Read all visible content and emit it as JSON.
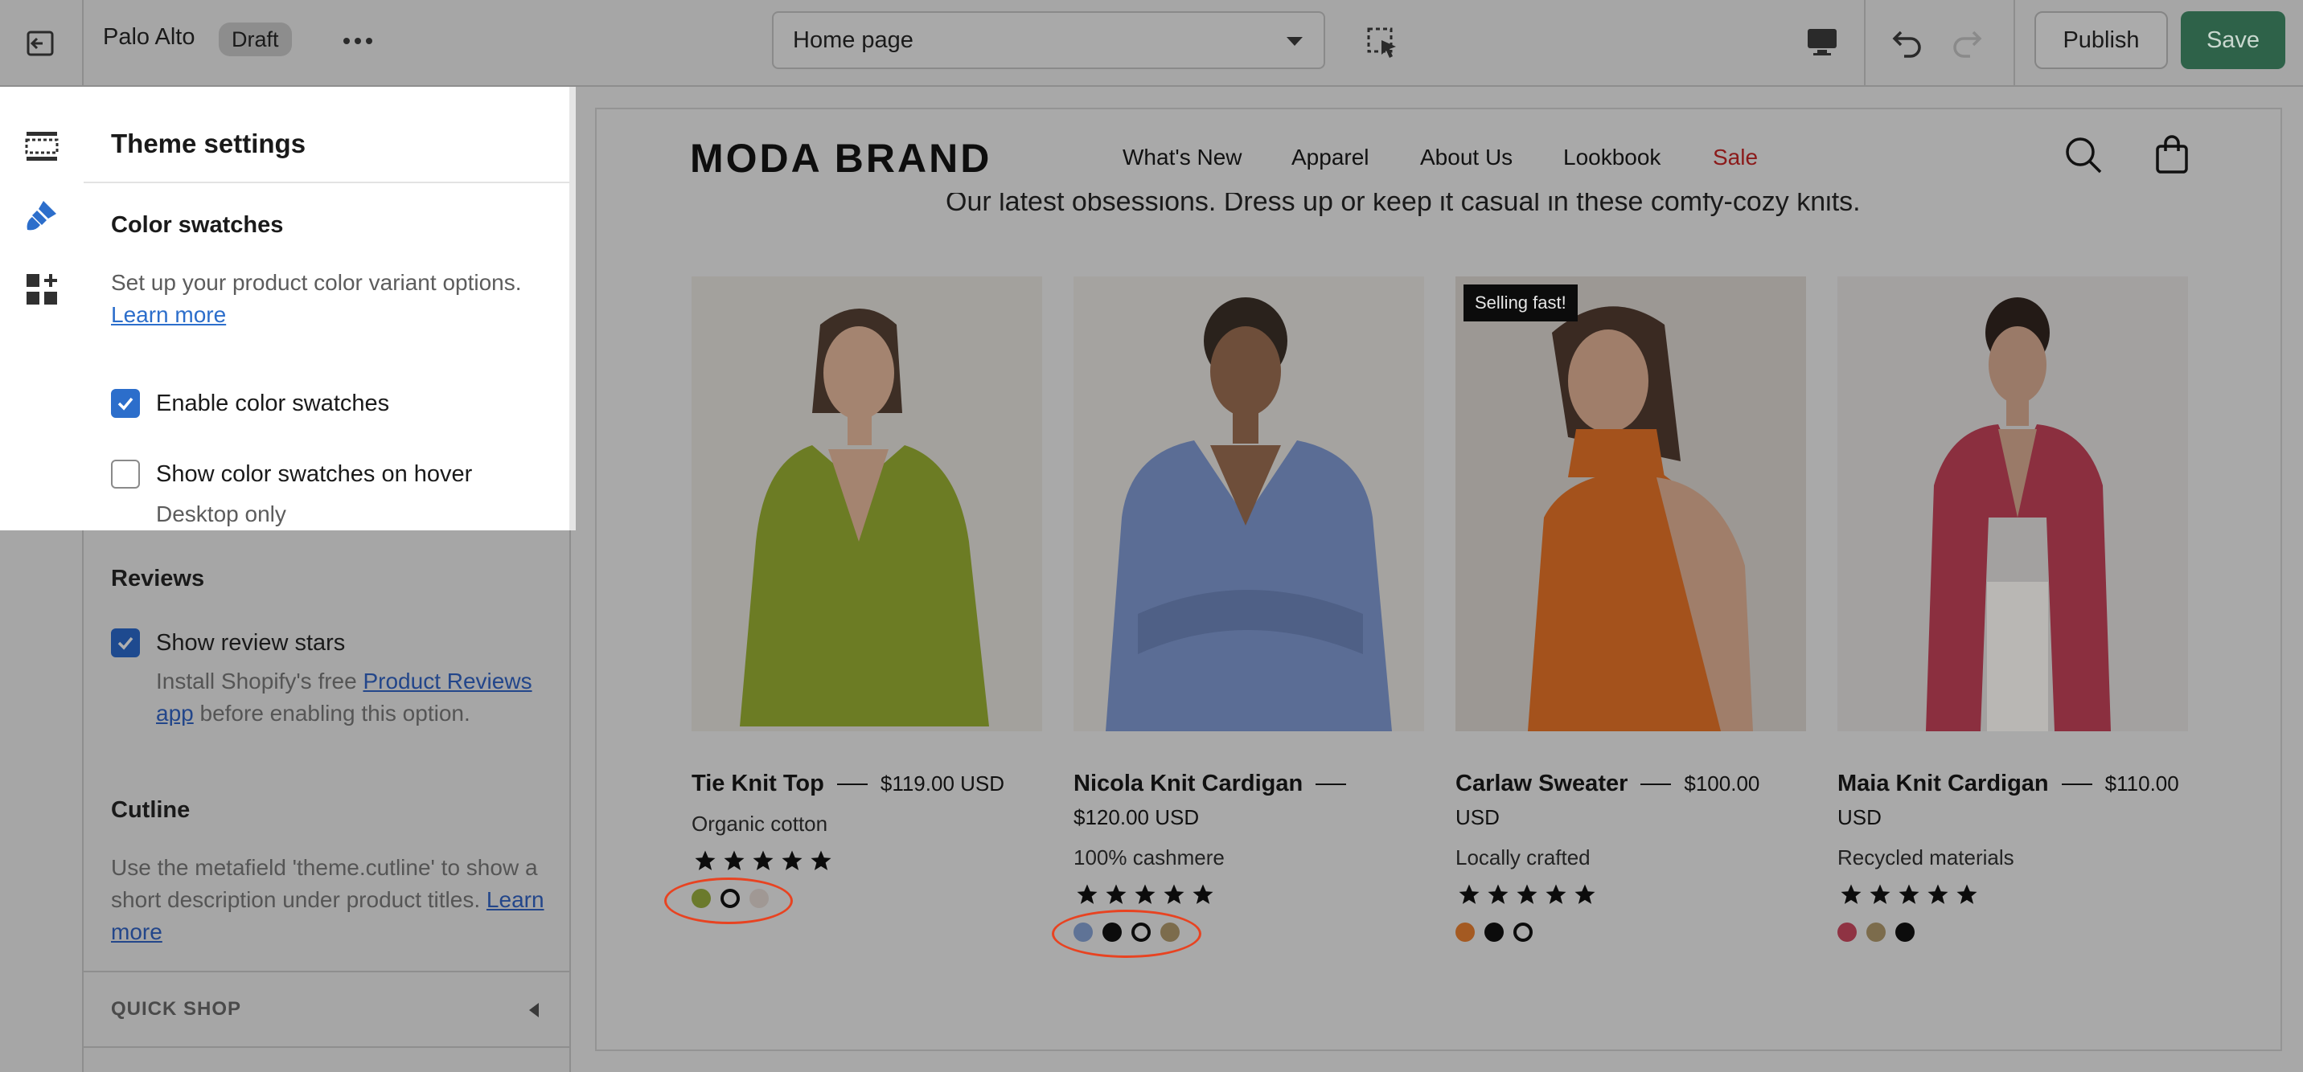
{
  "topbar": {
    "store_name": "Palo Alto",
    "status_badge": "Draft",
    "page_select_value": "Home page",
    "publish_label": "Publish",
    "save_label": "Save"
  },
  "sidebar": {
    "panel_title": "Theme settings",
    "color_swatches": {
      "heading": "Color swatches",
      "description": "Set up your product color variant options.",
      "learn_more": "Learn more",
      "enable_label": "Enable color swatches",
      "enable_checked": true,
      "hover_label": "Show color swatches on hover",
      "hover_checked": false,
      "hover_note": "Desktop only"
    },
    "reviews": {
      "heading": "Reviews",
      "show_stars_label": "Show review stars",
      "show_stars_checked": true,
      "note_prefix": "Install Shopify's free",
      "note_link": "Product Reviews app",
      "note_suffix": "before enabling this option."
    },
    "cutline": {
      "heading": "Cutline",
      "description": "Use the metafield 'theme.cutline' to show a short description under product titles.",
      "learn_more": "Learn more"
    },
    "quick_shop_label": "QUICK SHOP"
  },
  "preview": {
    "brand": "MODA BRAND",
    "nav": [
      "What's New",
      "Apparel",
      "About Us",
      "Lookbook",
      "Sale"
    ],
    "tagline": "Our latest obsessions. Dress up or keep it casual in these comfy-cozy knits.",
    "products": [
      {
        "name": "Tie Knit Top",
        "price": "$119.00 USD",
        "cutline": "Organic cotton",
        "rating": 5,
        "badge": "",
        "swatches": [
          "#6b7a2c",
          "empty",
          "#a09894"
        ]
      },
      {
        "name": "Nicola Knit Cardigan",
        "price": "$120.00 USD",
        "cutline": "100% cashmere",
        "rating": 5,
        "badge": "",
        "swatches": [
          "#5f7396",
          "dark",
          "empty",
          "#7c6c4c"
        ]
      },
      {
        "name": "Carlaw Sweater",
        "price": "$100.00 USD",
        "cutline": "Locally crafted",
        "rating": 5,
        "badge": "Selling fast!",
        "swatches": [
          "#a45a22",
          "dark",
          "empty"
        ]
      },
      {
        "name": "Maia Knit Cardigan",
        "price": "$110.00 USD",
        "cutline": "Recycled materials",
        "rating": 5,
        "badge": "",
        "swatches": [
          "#8f3343",
          "#7c6c4c",
          "dark"
        ]
      }
    ]
  },
  "colors": {
    "accent_blue": "#2c6ecb",
    "save_green": "#2e6249",
    "highlight_red": "#e84321",
    "sale_red": "#8b1a1a"
  }
}
